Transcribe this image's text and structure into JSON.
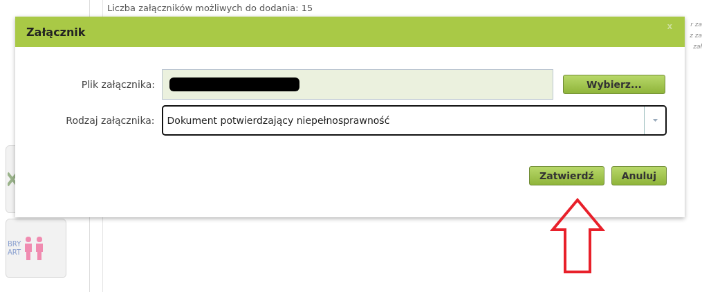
{
  "background": {
    "notice": "Liczba załączników możliwych do dodania: 15",
    "side_fragments": [
      "r za",
      "z za",
      "zał"
    ],
    "logo_tile": {
      "lines": [
        "BRY",
        "ART"
      ]
    }
  },
  "dialog": {
    "title": "Załącznik",
    "close": "x",
    "fields": [
      {
        "kind": "file",
        "label": "Plik załącznika:",
        "button": "Wybierz..."
      },
      {
        "kind": "select",
        "label": "Rodzaj załącznika:",
        "value": "Dokument potwierdzający niepełnosprawność",
        "focused": true
      }
    ],
    "buttons": [
      "Zatwierdź",
      "Anuluj"
    ]
  }
}
